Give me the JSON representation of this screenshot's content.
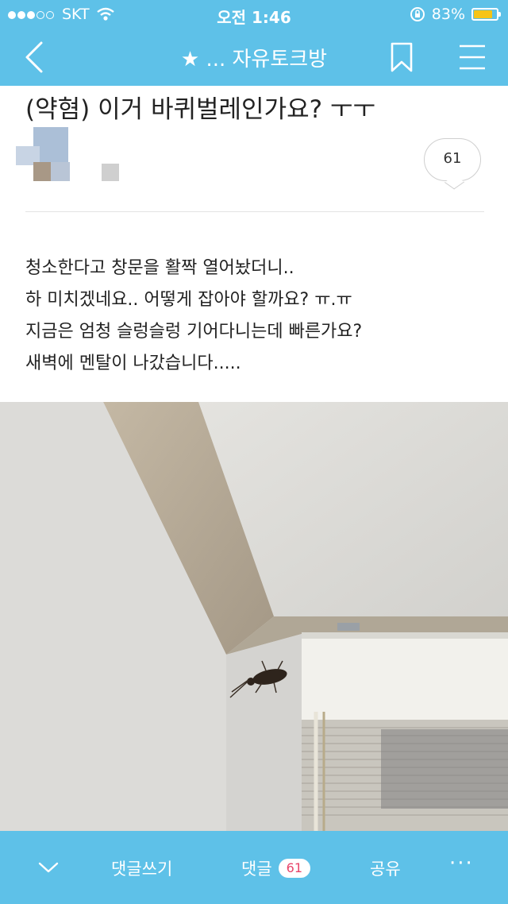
{
  "status_bar": {
    "carrier": "SKT",
    "time": "오전 1:46",
    "battery": "83%",
    "battery_level": 0.83
  },
  "nav": {
    "title": "★ ... 자유토크방",
    "icons": [
      "back-icon",
      "bookmark-icon",
      "menu-icon"
    ]
  },
  "post": {
    "title": "(약혐) 이거 바퀴벌레인가요? ㅜㅜ",
    "comment_count": "61",
    "body_lines": [
      "청소한다고 창문을 활짝 열어놨더니..",
      "하 미치겠네요.. 어떻게 잡아야 할까요? ㅠ.ㅠ",
      "지금은 엄청 슬렁슬렁 기어다니는데 빠른가요?",
      "새벽에 멘탈이 나갔습니다....."
    ]
  },
  "bottom_bar": {
    "write_comment": "댓글쓰기",
    "comments_label": "댓글",
    "comments_count": "61",
    "share": "공유",
    "more": "···"
  },
  "colors": {
    "brand": "#5ec1e8",
    "badge_text": "#e8456a",
    "battery_fill": "#f6c416"
  }
}
